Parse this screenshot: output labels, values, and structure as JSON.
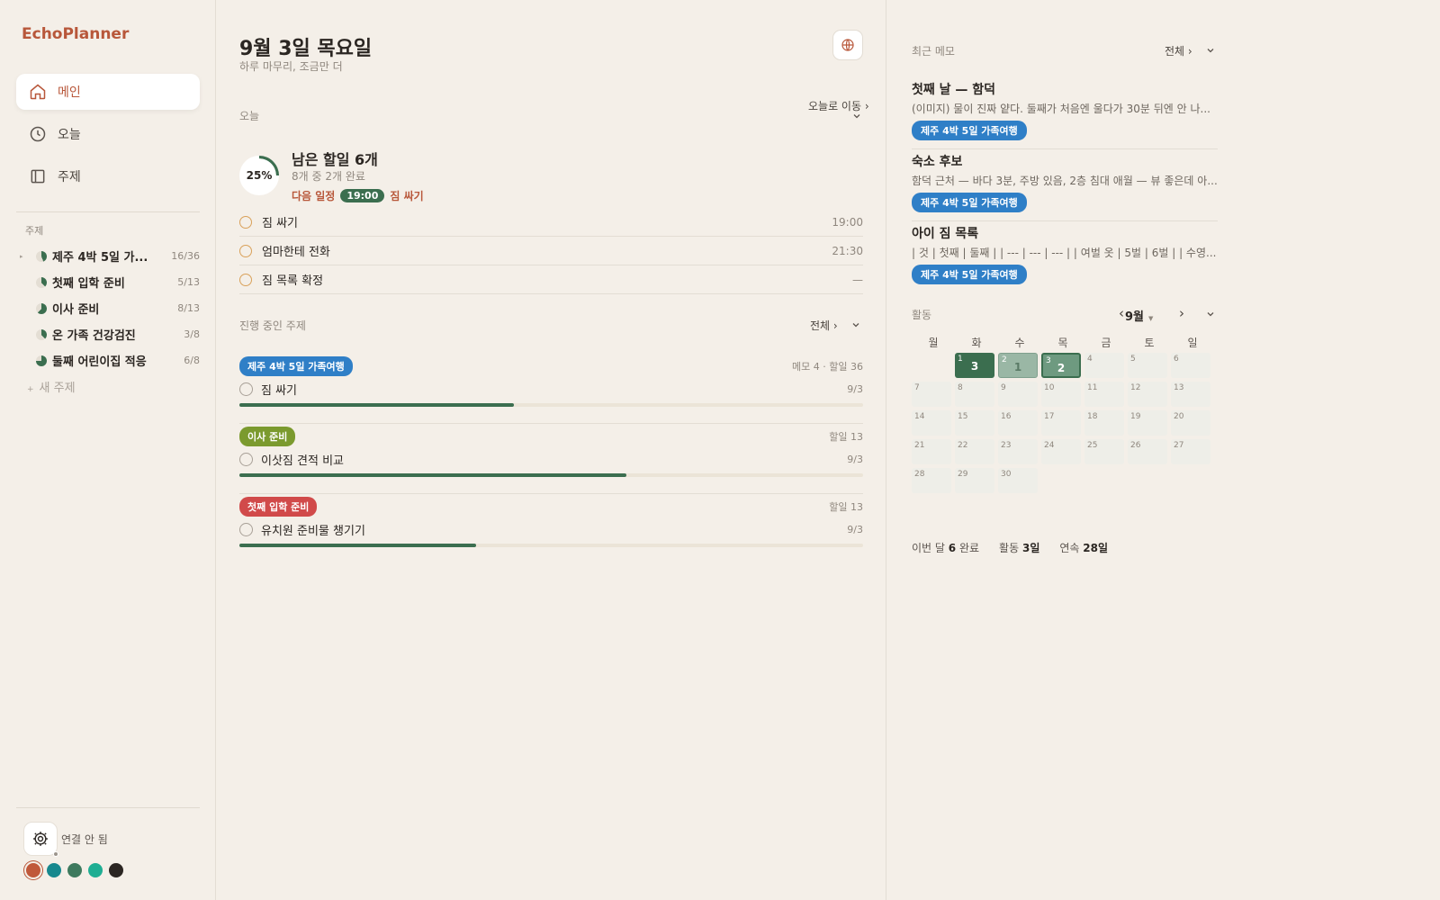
{
  "app": {
    "title": "EchoPlanner"
  },
  "nav": [
    {
      "label": "메인",
      "icon": "home-icon",
      "active": true
    },
    {
      "label": "오늘",
      "icon": "clock-icon",
      "active": false
    },
    {
      "label": "주제",
      "icon": "panel-icon",
      "active": false
    }
  ],
  "sidebar": {
    "topics_header": "주제",
    "topics": [
      {
        "name": "제주 4박 5일 가...",
        "count": "16/36",
        "expandable": true,
        "progress": 0.44
      },
      {
        "name": "첫째 입학 준비",
        "count": "5/13",
        "expandable": false,
        "progress": 0.38
      },
      {
        "name": "이사 준비",
        "count": "8/13",
        "expandable": false,
        "progress": 0.62
      },
      {
        "name": "온 가족 건강검진",
        "count": "3/8",
        "expandable": false,
        "progress": 0.38
      },
      {
        "name": "둘째 어린이집 적응",
        "count": "6/8",
        "expandable": false,
        "progress": 0.75
      }
    ],
    "new_topic": "새 주제",
    "connection_status": "연결 안 됨",
    "swatches": [
      "#c0583a",
      "#17888e",
      "#3e7a5e",
      "#1fae93",
      "#2b2622"
    ]
  },
  "main": {
    "date_title": "9월 3일 목요일",
    "date_subtitle": "하루 마무리, 조금만 더",
    "today_label": "오늘",
    "go_today": "오늘로 이동 ›",
    "progress_pct": "25%",
    "remaining": "남은 할일 6개",
    "completed_summary": "8개 중 2개 완료",
    "next_label": "다음 일정",
    "next_time": "19:00",
    "next_task": "짐 싸기",
    "tasks": [
      {
        "name": "짐 싸기",
        "time": "19:00"
      },
      {
        "name": "엄마한테 전화",
        "time": "21:30"
      },
      {
        "name": "짐 목록 확정",
        "time": "—"
      }
    ],
    "projects_label": "진행 중인 주제",
    "projects_all": "전체 ›",
    "projects": [
      {
        "tag": "제주 4박 5일 가족여행",
        "color": "#2f7fc7",
        "meta": "메모 4 · 할일 36",
        "task": "짐 싸기",
        "due": "9/3",
        "progress": 0.44
      },
      {
        "tag": "이사 준비",
        "color": "#7b9a2e",
        "meta": "할일 13",
        "task": "이삿짐 견적 비교",
        "due": "9/3",
        "progress": 0.62
      },
      {
        "tag": "첫째 입학 준비",
        "color": "#d14a4a",
        "meta": "할일 13",
        "task": "유치원 준비물 챙기기",
        "due": "9/3",
        "progress": 0.38
      }
    ]
  },
  "right": {
    "memos_label": "최근 메모",
    "memos_all": "전체 ›",
    "memos": [
      {
        "title": "첫째 날 — 함덕",
        "preview": "(이미지) 물이 진짜 얕다. 둘째가 처음엔 울다가 30분 뒤엔 안 나...",
        "tag": "제주 4박 5일 가족여행"
      },
      {
        "title": "숙소 후보",
        "preview": "함덕 근처 — 바다 3분, 주방 있음, 2층 침대 애월 — 뷰 좋은데 아...",
        "tag": "제주 4박 5일 가족여행"
      },
      {
        "title": "아이 짐 목록",
        "preview": "| 것 | 첫째 | 둘째 | | --- | --- | --- | | 여벌 옷 | 5벌 | 6벌 | | 수영...",
        "tag": "제주 4박 5일 가족여행"
      }
    ],
    "activity_label": "활동",
    "month": "9월",
    "weekdays": [
      "월",
      "화",
      "수",
      "목",
      "금",
      "토",
      "일"
    ],
    "days_count": 30,
    "first_weekday_offset": 1,
    "activity": [
      {
        "day": "1",
        "count": "3"
      },
      {
        "day": "2",
        "count": "1"
      },
      {
        "day": "3",
        "count": "2"
      }
    ],
    "stats": {
      "month_prefix": "이번 달",
      "month_value": "6",
      "month_suffix": "완료",
      "active_prefix": "활동",
      "active_value": "3일",
      "streak_prefix": "연속",
      "streak_value": "28일"
    }
  }
}
